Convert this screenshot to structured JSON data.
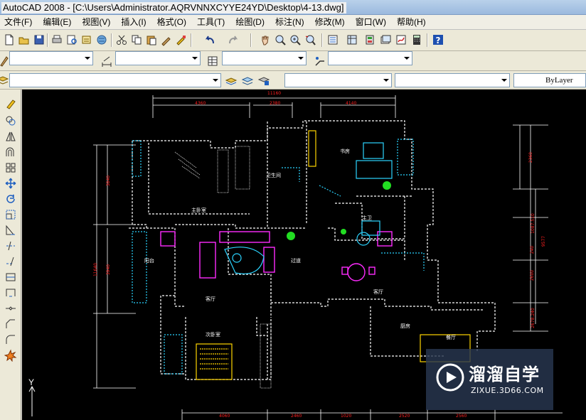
{
  "window": {
    "title": "AutoCAD 2008 - [C:\\Users\\Administrator.AQRVNNXCYYE24YD\\Desktop\\4-13.dwg]"
  },
  "menu": [
    {
      "label": "文件(F)"
    },
    {
      "label": "编辑(E)"
    },
    {
      "label": "视图(V)"
    },
    {
      "label": "插入(I)"
    },
    {
      "label": "格式(O)"
    },
    {
      "label": "工具(T)"
    },
    {
      "label": "绘图(D)"
    },
    {
      "label": "标注(N)"
    },
    {
      "label": "修改(M)"
    },
    {
      "label": "窗口(W)"
    },
    {
      "label": "帮助(H)"
    }
  ],
  "properties": {
    "lineweight": "ByLayer"
  },
  "drawing": {
    "dims_top": [
      "11160",
      "4360",
      "2380",
      "4140"
    ],
    "dims_bottom": [
      "4060",
      "2460",
      "1020",
      "2520",
      "2560"
    ],
    "dims_left": [
      "3840",
      "11640",
      "3940"
    ],
    "dims_right": [
      "2360",
      "1087.510",
      "240",
      "2600",
      "2678.240",
      "9577"
    ],
    "rooms": [
      "书房",
      "主卧室",
      "卫生间",
      "主卫",
      "阳台",
      "过道",
      "客厅",
      "客厅",
      "厨房",
      "次卧室",
      "餐厅"
    ],
    "ucs_label": "Y"
  },
  "watermark": {
    "brand": "溜溜自学",
    "url": "ZIXUE.3D66.COM"
  },
  "colors": {
    "canvas": "#000000",
    "dimension": "#ff2020",
    "wall": "#ffffff"
  }
}
